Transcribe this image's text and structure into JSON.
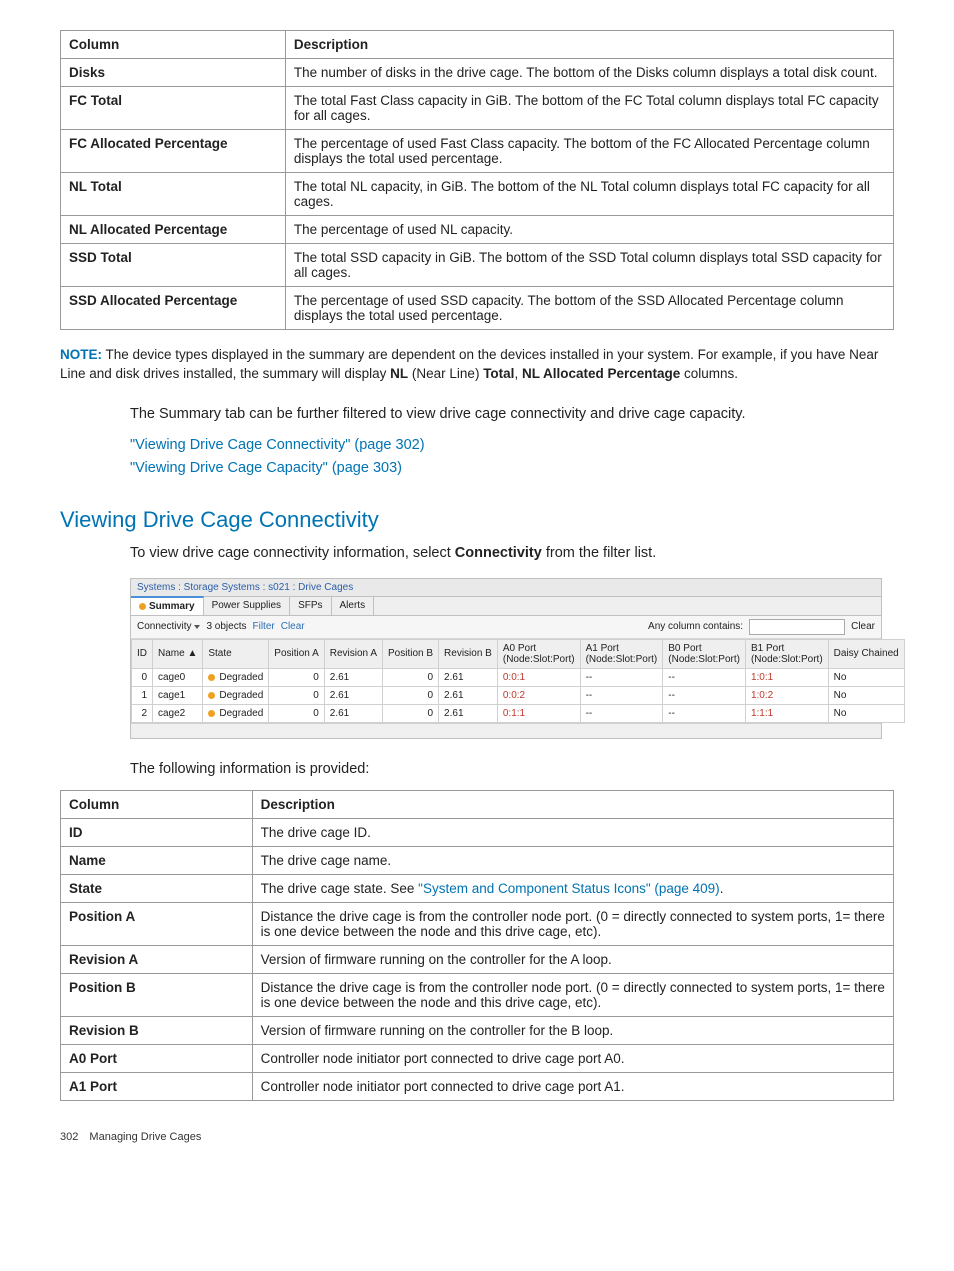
{
  "table1": {
    "header_col1": "Column",
    "header_col2": "Description",
    "rows": [
      {
        "c": "Disks",
        "d": "The number of disks in the drive cage. The bottom of the Disks column displays a total disk count."
      },
      {
        "c": "FC Total",
        "d": "The total Fast Class capacity in GiB. The bottom of the FC Total column displays total FC capacity for all cages."
      },
      {
        "c": "FC Allocated Percentage",
        "d": "The percentage of used Fast Class capacity. The bottom of the FC Allocated Percentage column displays the total used percentage."
      },
      {
        "c": "NL Total",
        "d": "The total NL capacity, in GiB. The bottom of the NL Total column displays total FC capacity for all cages."
      },
      {
        "c": "NL Allocated Percentage",
        "d": "The percentage of used NL capacity."
      },
      {
        "c": "SSD Total",
        "d": "The total SSD capacity in GiB. The bottom of the SSD Total column displays total SSD capacity for all cages."
      },
      {
        "c": "SSD Allocated Percentage",
        "d": "The percentage of used SSD capacity. The bottom of the SSD Allocated Percentage column displays the total used percentage."
      }
    ]
  },
  "note": {
    "label": "NOTE:",
    "text_part1": "The device types displayed in the summary are dependent on the devices installed in your system. For example, if you have Near Line and disk drives installed, the summary will display ",
    "bold1": "NL",
    "paren1": " (Near Line) ",
    "bold2": "Total",
    "comma": ", ",
    "bold3": "NL Allocated Percentage",
    "text_part2": " columns."
  },
  "summary_text": "The Summary tab can be further filtered to view drive cage connectivity and drive cage capacity.",
  "link1": "\"Viewing Drive Cage Connectivity\" (page 302)",
  "link2": "\"Viewing Drive Cage Capacity\" (page 303)",
  "heading": "Viewing Drive Cage Connectivity",
  "instruction_pre": "To view drive cage connectivity information, select ",
  "instruction_bold": "Connectivity",
  "instruction_post": " from the filter list.",
  "screenshot": {
    "breadcrumb": "Systems : Storage Systems : s021 : Drive Cages",
    "tabs": [
      "Summary",
      "Power Supplies",
      "SFPs",
      "Alerts"
    ],
    "toolbar": {
      "filter_dropdown": "Connectivity",
      "objects": "3 objects",
      "filter_link": "Filter",
      "clear_link": "Clear",
      "any_column": "Any column contains:",
      "clear_btn": "Clear"
    },
    "columns": [
      "ID",
      "Name",
      "State",
      "Position A",
      "Revision A",
      "Position B",
      "Revision B",
      "A0 Port (Node:Slot:Port)",
      "A1 Port (Node:Slot:Port)",
      "B0 Port (Node:Slot:Port)",
      "B1 Port (Node:Slot:Port)",
      "Daisy Chained"
    ],
    "rows": [
      {
        "id": "0",
        "name": "cage0",
        "state": "Degraded",
        "posA": "0",
        "revA": "2.61",
        "posB": "0",
        "revB": "2.61",
        "a0": "0:0:1",
        "a1": "--",
        "b0": "--",
        "b1": "1:0:1",
        "daisy": "No"
      },
      {
        "id": "1",
        "name": "cage1",
        "state": "Degraded",
        "posA": "0",
        "revA": "2.61",
        "posB": "0",
        "revB": "2.61",
        "a0": "0:0:2",
        "a1": "--",
        "b0": "--",
        "b1": "1:0:2",
        "daisy": "No"
      },
      {
        "id": "2",
        "name": "cage2",
        "state": "Degraded",
        "posA": "0",
        "revA": "2.61",
        "posB": "0",
        "revB": "2.61",
        "a0": "0:1:1",
        "a1": "--",
        "b0": "--",
        "b1": "1:1:1",
        "daisy": "No"
      }
    ]
  },
  "following_info": "The following information is provided:",
  "table2": {
    "header_col1": "Column",
    "header_col2": "Description",
    "rows": [
      {
        "c": "ID",
        "d": "The drive cage ID."
      },
      {
        "c": "Name",
        "d": "The drive cage name."
      },
      {
        "c": "State",
        "d_pre": "The drive cage state. See ",
        "d_link": "\"System and Component Status Icons\" (page 409)",
        "d_post": "."
      },
      {
        "c": "Position A",
        "d": "Distance the drive cage is from the controller node port. (0 = directly connected to system ports, 1= there is one device between the node and this drive cage, etc)."
      },
      {
        "c": "Revision A",
        "d": "Version of firmware running on the controller for the A loop."
      },
      {
        "c": "Position B",
        "d": "Distance the drive cage is from the controller node port. (0 = directly connected to system ports, 1= there is one device between the node and this drive cage, etc)."
      },
      {
        "c": "Revision B",
        "d": "Version of firmware running on the controller for the B loop."
      },
      {
        "c": "A0 Port",
        "d": "Controller node initiator port connected to drive cage port A0."
      },
      {
        "c": "A1 Port",
        "d": "Controller node initiator port connected to drive cage port A1."
      }
    ]
  },
  "footer": {
    "page_number": "302",
    "chapter": "Managing Drive Cages"
  }
}
